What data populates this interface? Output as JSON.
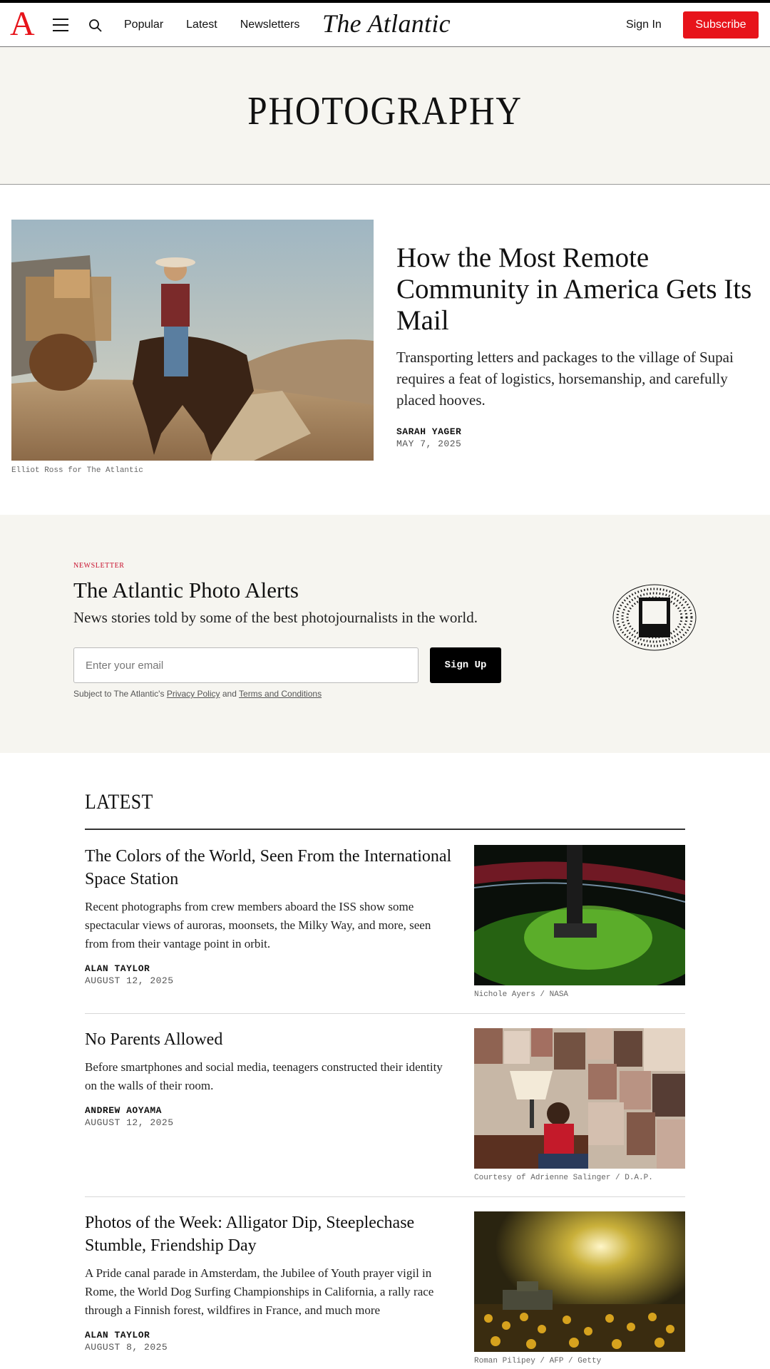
{
  "header": {
    "logo": "A",
    "nav": [
      "Popular",
      "Latest",
      "Newsletters"
    ],
    "wordmark": "The Atlantic",
    "sign_in": "Sign In",
    "subscribe": "Subscribe",
    "brand_color": "#e7131a"
  },
  "section": {
    "title": "PHOTOGRAPHY"
  },
  "hero": {
    "title": "How the Most Remote Community in America Gets Its Mail",
    "dek": "Transporting letters and packages to the village of Supai requires a feat of logistics, horsemanship, and carefully placed hooves.",
    "author": "SARAH YAGER",
    "date": "MAY 7, 2025",
    "credit": "Elliot Ross for The Atlantic"
  },
  "newsletter": {
    "kicker": "NEWSLETTER",
    "title": "The Atlantic Photo Alerts",
    "description": "News stories told by some of the best photojournalists in the world.",
    "email_placeholder": "Enter your email",
    "button": "Sign Up",
    "legal_prefix": "Subject to The Atlantic's",
    "privacy_link": "Privacy Policy",
    "legal_and": "and",
    "terms_link": "Terms and Conditions"
  },
  "latest": {
    "heading": "LATEST",
    "items": [
      {
        "title": "The Colors of the World, Seen From the International Space Station",
        "dek": "Recent photographs from crew members aboard the ISS show some spectacular views of auroras, moonsets, the Milky Way, and more, seen from from their vantage point in orbit.",
        "author": "ALAN TAYLOR",
        "date": "AUGUST 12, 2025",
        "credit": "Nichole Ayers / NASA"
      },
      {
        "title": "No Parents Allowed",
        "dek": "Before smartphones and social media, teenagers constructed their identity on the walls of their room.",
        "author": "ANDREW AOYAMA",
        "date": "AUGUST 12, 2025",
        "credit": "Courtesy of Adrienne Salinger / D.A.P."
      },
      {
        "title": "Photos of the Week: Alligator Dip, Steeplechase Stumble, Friendship Day",
        "dek": "A Pride canal parade in Amsterdam, the Jubilee of Youth prayer vigil in Rome, the World Dog Surfing Championships in California, a rally race through a Finnish forest, wildfires in France, and much more",
        "author": "ALAN TAYLOR",
        "date": "AUGUST 8, 2025",
        "credit": "Roman Pilipey / AFP / Getty"
      }
    ]
  }
}
